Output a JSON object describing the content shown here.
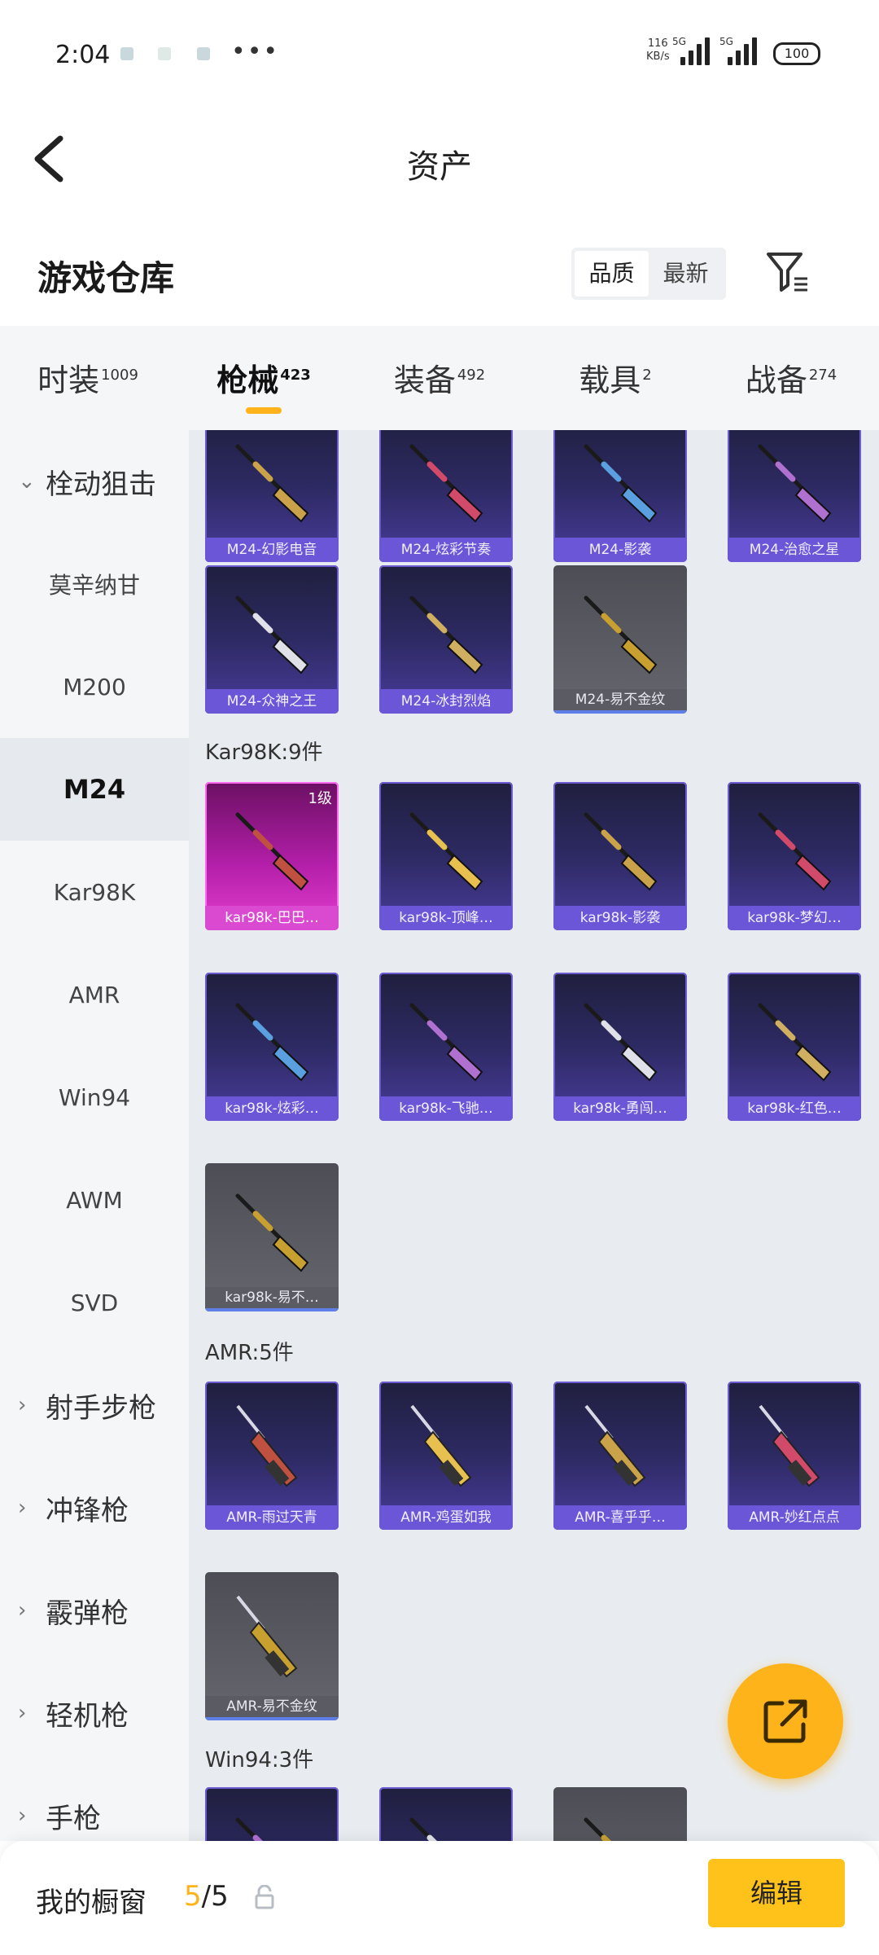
{
  "status_bar": {
    "time": "2:04",
    "net_speed_value": "116",
    "net_speed_unit": "KB/s",
    "signal_1": "5G",
    "signal_2": "5G",
    "battery": "100"
  },
  "header": {
    "title": "资产"
  },
  "warehouse": {
    "title": "游戏仓库",
    "sort_quality": "品质",
    "sort_newest": "最新"
  },
  "tabs": [
    {
      "label": "时装",
      "count": "1009"
    },
    {
      "label": "枪械",
      "count": "423"
    },
    {
      "label": "装备",
      "count": "492"
    },
    {
      "label": "载具",
      "count": "2"
    },
    {
      "label": "战备",
      "count": "274"
    }
  ],
  "sidebar": {
    "group_sniper": "栓动狙击",
    "items": [
      "莫辛纳甘",
      "M200",
      "M24",
      "Kar98K",
      "AMR",
      "Win94",
      "AWM",
      "SVD"
    ],
    "groups_collapsed": [
      "射手步枪",
      "冲锋枪",
      "霰弹枪",
      "轻机枪",
      "手枪"
    ]
  },
  "sections": {
    "kar98k_label": "Kar98K:9件",
    "amr_label": "AMR:5件",
    "win94_label": "Win94:3件"
  },
  "m24_items": [
    "M24-幻影电音",
    "M24-炫彩节奏",
    "M24-影袭",
    "M24-治愈之星",
    "M24-众神之王",
    "M24-冰封烈焰",
    "M24-易不金纹"
  ],
  "kar98k_items": [
    "kar98k-巴巴…",
    "kar98k-顶峰…",
    "kar98k-影袭",
    "kar98k-梦幻…",
    "kar98k-炫彩…",
    "kar98k-飞驰…",
    "kar98k-勇闯…",
    "kar98k-红色…",
    "kar98k-易不…"
  ],
  "kar98k_level": "1级",
  "amr_items": [
    "AMR-雨过天青",
    "AMR-鸡蛋如我",
    "AMR-喜乎乎…",
    "AMR-妙红点点",
    "AMR-易不金纹"
  ],
  "bottom": {
    "label": "我的橱窗",
    "current": "5",
    "total": "/5",
    "edit": "编辑"
  },
  "colors": {
    "accent": "#ffb31a",
    "card_purple": "#2d2a63",
    "card_pink": "#b21ea8",
    "card_gray": "#5c5d64"
  }
}
